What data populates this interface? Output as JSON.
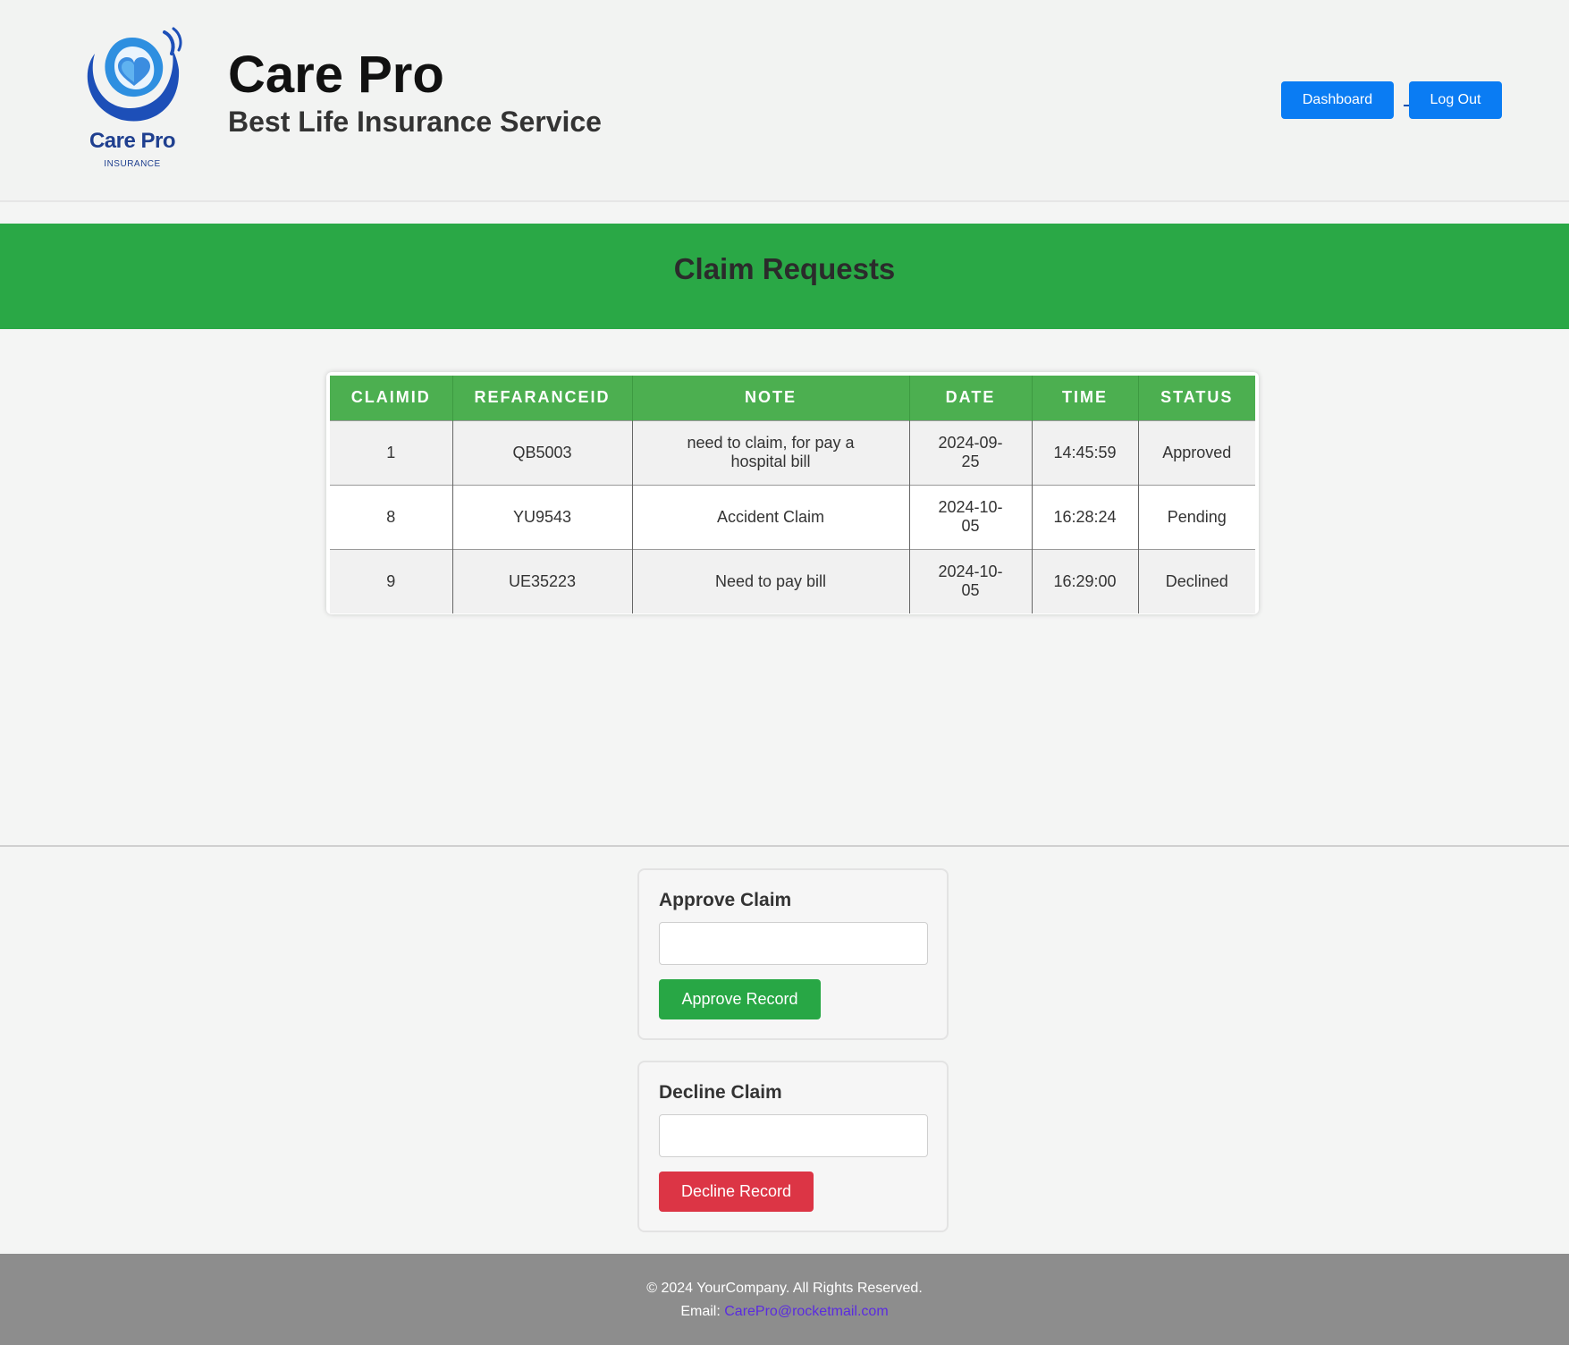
{
  "header": {
    "logo_text": "Care Pro",
    "logo_subtext": "INSURANCE",
    "title": "Care Pro",
    "subtitle": "Best Life Insurance Service",
    "nav": {
      "dashboard_label": "Dashboard",
      "logout_label": "Log Out"
    }
  },
  "banner": {
    "title": "Claim Requests"
  },
  "table": {
    "columns": [
      "CLAIMID",
      "REFARANCEID",
      "NOTE",
      "DATE",
      "TIME",
      "STATUS"
    ],
    "rows": [
      {
        "claimid": "1",
        "referenceid": "QB5003",
        "note": "need to claim, for pay a hospital bill",
        "date": "2024-09-25",
        "time": "14:45:59",
        "status": "Approved"
      },
      {
        "claimid": "8",
        "referenceid": "YU9543",
        "note": "Accident Claim",
        "date": "2024-10-05",
        "time": "16:28:24",
        "status": "Pending"
      },
      {
        "claimid": "9",
        "referenceid": "UE35223",
        "note": "Need to pay bill",
        "date": "2024-10-05",
        "time": "16:29:00",
        "status": "Declined"
      }
    ]
  },
  "approve": {
    "title": "Approve Claim",
    "input_value": "",
    "button_label": "Approve Record"
  },
  "decline": {
    "title": "Decline Claim",
    "input_value": "",
    "button_label": "Decline Record"
  },
  "footer": {
    "copyright": "© 2024 YourCompany. All Rights Reserved.",
    "email_label": "Email:",
    "email": "CarePro@rocketmail.com"
  },
  "colors": {
    "primary_blue": "#0a7cf3",
    "banner_green": "#2aa846",
    "table_header_green": "#4caf50",
    "approve_green": "#28a745",
    "decline_red": "#dc3545",
    "footer_gray": "#8d8d8d",
    "logo_blue": "#1f3f8f"
  },
  "icons": {
    "logo": "heart-in-hands-icon"
  }
}
